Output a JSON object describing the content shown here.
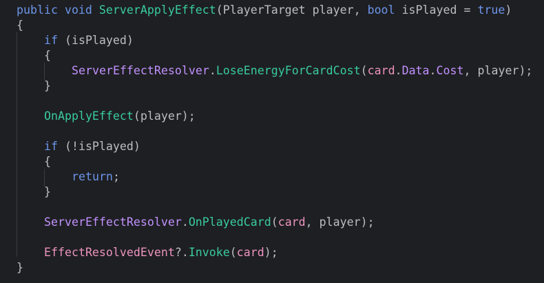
{
  "code": {
    "line1": {
      "kw_public": "public",
      "kw_void": "void",
      "method_name": "ServerApplyEffect",
      "open_paren": "(",
      "type_player_target": "PlayerTarget",
      "param_player": " player, ",
      "kw_bool": "bool",
      "param_is_played": " isPlayed = ",
      "kw_true": "true",
      "close_paren": ")"
    },
    "line2": {
      "brace": "{"
    },
    "line3": {
      "kw_if": "if",
      "cond": " (isPlayed)"
    },
    "line4": {
      "brace": "{"
    },
    "line5": {
      "class_resolver": "ServerEffectResolver",
      "dot1": ".",
      "method_lose_energy": "LoseEnergyForCardCost",
      "open_paren": "(",
      "local_card": "card",
      "dot2": ".",
      "prop_data": "Data",
      "dot3": ".",
      "prop_cost": "Cost",
      "rest": ", player);"
    },
    "line6": {
      "brace": "}"
    },
    "line7": {
      "method_on_apply": "OnApplyEffect",
      "rest": "(player);"
    },
    "line8": {
      "kw_if": "if",
      "cond": " (!isPlayed)"
    },
    "line9": {
      "brace": "{"
    },
    "line10": {
      "kw_return": "return",
      "semicolon": ";"
    },
    "line11": {
      "brace": "}"
    },
    "line12": {
      "class_resolver": "ServerEffectResolver",
      "dot": ".",
      "method_on_played_card": "OnPlayedCard",
      "open_paren": "(",
      "local_card": "card",
      "rest": ", player);"
    },
    "line13": {
      "event_name": "EffectResolvedEvent",
      "null_conditional": "?.",
      "method_invoke": "Invoke",
      "open_paren": "(",
      "local_card": "card",
      "rest": ");"
    },
    "line14": {
      "brace": "}"
    }
  },
  "colors": {
    "background": "#1e1f22",
    "keyword": "#6c95eb",
    "method": "#39cc9b",
    "class": "#c191ff",
    "static_member": "#ed94c0",
    "plain": "#bdbec4"
  }
}
